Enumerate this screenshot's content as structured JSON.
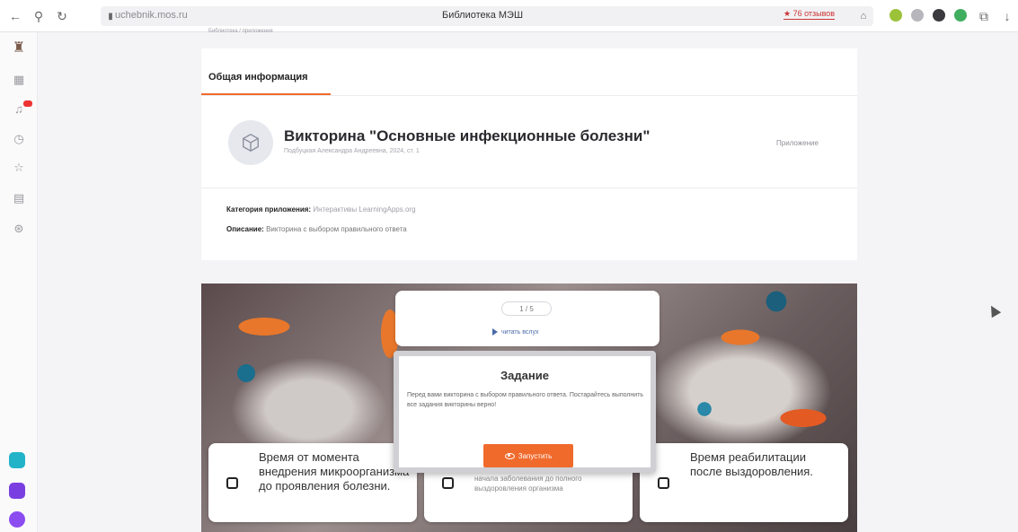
{
  "browser": {
    "url": "uchebnik.mos.ru",
    "tab_title": "Библиотека МЭШ",
    "reviews_badge": "★ 76 отзывов"
  },
  "breadcrumb": "Библиотека / приложения",
  "tabs": [
    {
      "label": "Общая информация",
      "active": true
    }
  ],
  "app": {
    "title": "Викторина \"Основные инфекционные болезни\"",
    "author_line": "Подбуцкая Александра Андреевна, 2024, ст. 1",
    "type": "Приложение",
    "category_label": "Категория приложения:",
    "category_value": "Интерактивы LearningApps.org",
    "description_label": "Описание:",
    "description_value": "Викторина с выбором правильного ответа"
  },
  "quiz": {
    "counter": "1 / 5",
    "listen_label": "читать вслух",
    "task_title": "Задание",
    "task_text": "Перед вами викторина с выбором правильного ответа. Постарайтесь выполнить все задания викторины верно!",
    "launch_label": "Запустить",
    "answers": [
      {
        "text": "Время от момента внедрения микроорганизма до проявления болезни.",
        "small": false
      },
      {
        "text": "начала заболевания до полного выздоровления организма",
        "small": true
      },
      {
        "text": "Время реабилитации после выздоровления.",
        "small": false
      }
    ]
  },
  "colors": {
    "accent": "#f06a2c",
    "link": "#4a6aa8"
  }
}
